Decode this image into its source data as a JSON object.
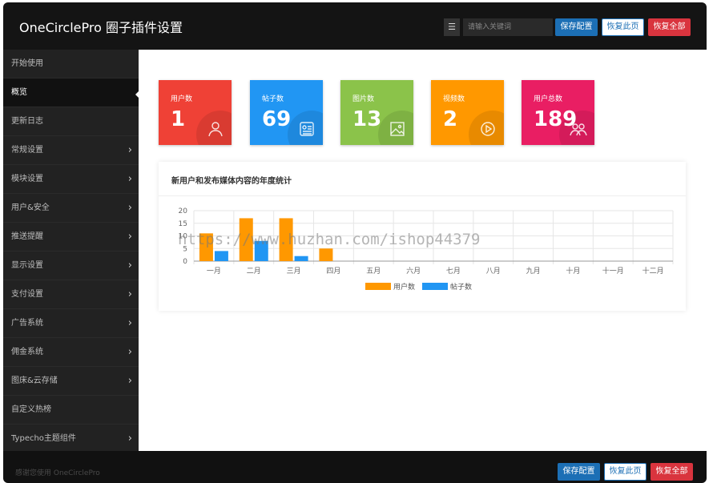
{
  "header": {
    "title": "OneCirclePro 圈子插件设置",
    "menu_icon": "list-icon",
    "search_placeholder": "请输入关键词",
    "buttons": {
      "save": "保存配置",
      "restore_page": "恢复此页",
      "restore_all": "恢复全部"
    }
  },
  "sidebar": {
    "items": [
      {
        "label": "开始使用",
        "has_children": false,
        "active": false
      },
      {
        "label": "概览",
        "has_children": false,
        "active": true
      },
      {
        "label": "更新日志",
        "has_children": false,
        "active": false
      },
      {
        "label": "常规设置",
        "has_children": true,
        "active": false
      },
      {
        "label": "模块设置",
        "has_children": true,
        "active": false
      },
      {
        "label": "用户&安全",
        "has_children": true,
        "active": false
      },
      {
        "label": "推送提醒",
        "has_children": true,
        "active": false
      },
      {
        "label": "显示设置",
        "has_children": true,
        "active": false
      },
      {
        "label": "支付设置",
        "has_children": true,
        "active": false
      },
      {
        "label": "广告系统",
        "has_children": true,
        "active": false
      },
      {
        "label": "佣金系统",
        "has_children": true,
        "active": false
      },
      {
        "label": "图床&云存储",
        "has_children": true,
        "active": false
      },
      {
        "label": "自定义热榜",
        "has_children": false,
        "active": false
      },
      {
        "label": "Typecho主题组件",
        "has_children": true,
        "active": false
      }
    ]
  },
  "stats": [
    {
      "label": "用户数",
      "value": "1",
      "color": "#ef4136",
      "icon": "user-icon"
    },
    {
      "label": "帖子数",
      "value": "69",
      "color": "#2196f3",
      "icon": "post-icon"
    },
    {
      "label": "图片数",
      "value": "13",
      "color": "#8bc34a",
      "icon": "image-icon"
    },
    {
      "label": "视频数",
      "value": "2",
      "color": "#ff9800",
      "icon": "play-icon"
    },
    {
      "label": "用户总数",
      "value": "189",
      "color": "#e91e63",
      "icon": "users-icon"
    }
  ],
  "panel": {
    "title": "新用户和发布媒体内容的年度统计"
  },
  "chart_data": {
    "type": "bar",
    "categories": [
      "一月",
      "二月",
      "三月",
      "四月",
      "五月",
      "六月",
      "七月",
      "八月",
      "九月",
      "十月",
      "十一月",
      "十二月"
    ],
    "series": [
      {
        "name": "用户数",
        "values": [
          11,
          17,
          17,
          5,
          0,
          0,
          0,
          0,
          0,
          0,
          0,
          0
        ],
        "color": "#ff9800"
      },
      {
        "name": "帖子数",
        "values": [
          4,
          8,
          2,
          0,
          0,
          0,
          0,
          0,
          0,
          0,
          0,
          0
        ],
        "color": "#2196f3"
      }
    ],
    "yticks": [
      "0",
      "5",
      "10",
      "15",
      "20"
    ],
    "ylim": [
      0,
      20
    ],
    "grid": true,
    "legend": "bottom"
  },
  "footer": {
    "text": "感谢您使用 OneCirclePro"
  },
  "watermark": "https://www.huzhan.com/ishop44379"
}
